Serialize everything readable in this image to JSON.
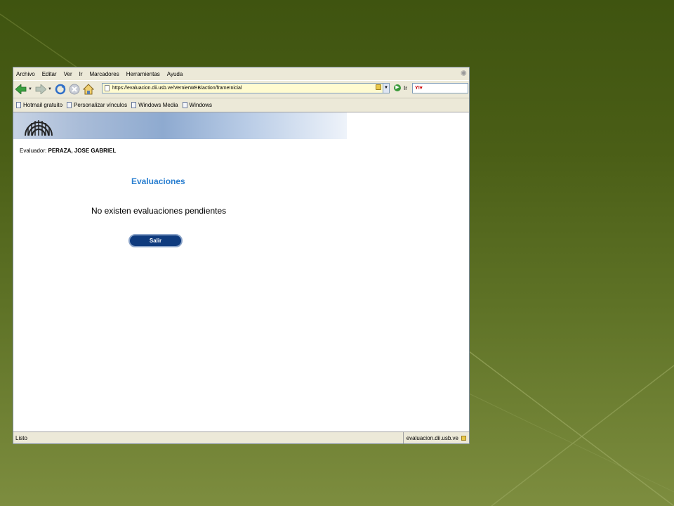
{
  "menubar": {
    "items": [
      "Archivo",
      "Editar",
      "Ver",
      "Ir",
      "Marcadores",
      "Herramientas",
      "Ayuda"
    ]
  },
  "navbar": {
    "url": "https://evaluacion.dii.usb.ve/VernierWEB/action/frameInicial",
    "go_label": "Ir",
    "search_engine_icon": "yahoo-icon"
  },
  "bookmarks": {
    "items": [
      "Hotmail gratuito",
      "Personalizar vínculos",
      "Windows Media",
      "Windows"
    ]
  },
  "page": {
    "evaluator_label": "Evaluador:",
    "evaluator_name": "PERAZA, JOSE GABRIEL",
    "title": "Evaluaciones",
    "message": "No existen evaluaciones pendientes",
    "exit_button": "Salir"
  },
  "statusbar": {
    "status": "Listo",
    "domain": "evaluacion.dii.usb.ve"
  },
  "colors": {
    "title_blue": "#2a7fd0",
    "button_navy": "#0f3b7e",
    "url_bg": "#fffbd0"
  }
}
